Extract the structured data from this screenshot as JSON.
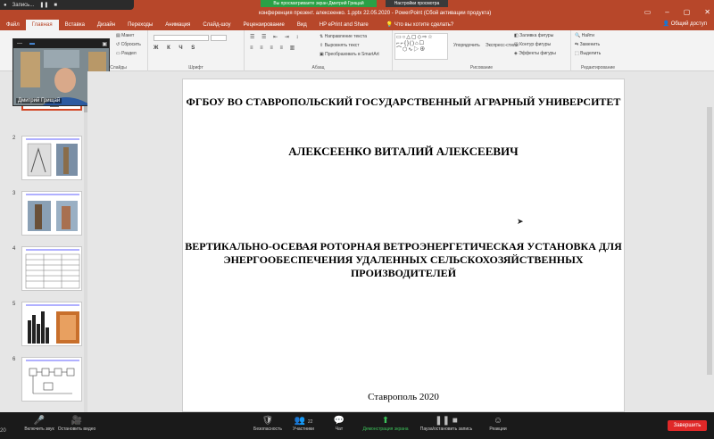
{
  "titlebar": {
    "recording_label": "Запись...",
    "title": "конференция презент. алексеенко. 1.pptx 22.05.2020 - PowerPoint (Сбой активации продукта)",
    "share_banner": "Вы просматриваете экран Дмитрий Грищай",
    "view_options": "Настройки просмотра"
  },
  "tabs": [
    {
      "label": "Файл"
    },
    {
      "label": "Главная"
    },
    {
      "label": "Вставка"
    },
    {
      "label": "Дизайн"
    },
    {
      "label": "Переходы"
    },
    {
      "label": "Анимация"
    },
    {
      "label": "Слайд-шоу"
    },
    {
      "label": "Рецензирование"
    },
    {
      "label": "Вид"
    },
    {
      "label": "HP ePrint and Share"
    }
  ],
  "tell_me": "Что вы хотите сделать?",
  "share_button": "Общий доступ",
  "ribbon": {
    "slides_group": "Слайды",
    "layout": "Макет",
    "reset": "Сбросить",
    "section": "Раздел",
    "font_group": "Шрифт",
    "paragraph_group": "Абзац",
    "text_direction": "Направление текста",
    "align_text": "Выровнять текст",
    "smartart": "Преобразовать в SmartArt",
    "drawing_group": "Рисование",
    "arrange": "Упорядочить",
    "quick_styles": "Экспресс-стили",
    "shape_fill": "Заливка фигуры",
    "shape_outline": "Контур фигуры",
    "shape_effects": "Эффекты фигуры",
    "editing_group": "Редактирование",
    "find": "Найти",
    "replace": "Заменить",
    "select": "Выделить"
  },
  "thumbnails": [
    "2",
    "3",
    "4",
    "5",
    "6"
  ],
  "video": {
    "name": "Дмитрий Грищай"
  },
  "slide": {
    "university": "ФГБОУ ВО СТАВРОПОЛЬСКИЙ ГОСУДАРСТВЕННЫЙ АГРАРНЫЙ УНИВЕРСИТЕТ",
    "author": "АЛЕКСЕЕНКО ВИТАЛИЙ АЛЕКСЕЕВИЧ",
    "theme": "ВЕРТИКАЛЬНО-ОСЕВАЯ РОТОРНАЯ ВЕТРОЭНЕРГЕТИЧЕСКАЯ УСТАНОВКА ДЛЯ ЭНЕРГООБЕСПЕЧЕНИЯ УДАЛЕННЫХ СЕЛЬСКОХОЗЯЙСТВЕННЫХ ПРОИЗВОДИТЕЛЕЙ",
    "city": "Ставрополь 2020"
  },
  "meeting": {
    "left_num": "20",
    "mute": "Включить звук",
    "video": "Остановить видео",
    "security": "Безопасность",
    "participants": "Участники",
    "participants_count": "22",
    "chat": "Чат",
    "share": "Демонстрация экрана",
    "record": "Пауза/остановить запись",
    "reactions": "Реакции",
    "end": "Завершить"
  }
}
